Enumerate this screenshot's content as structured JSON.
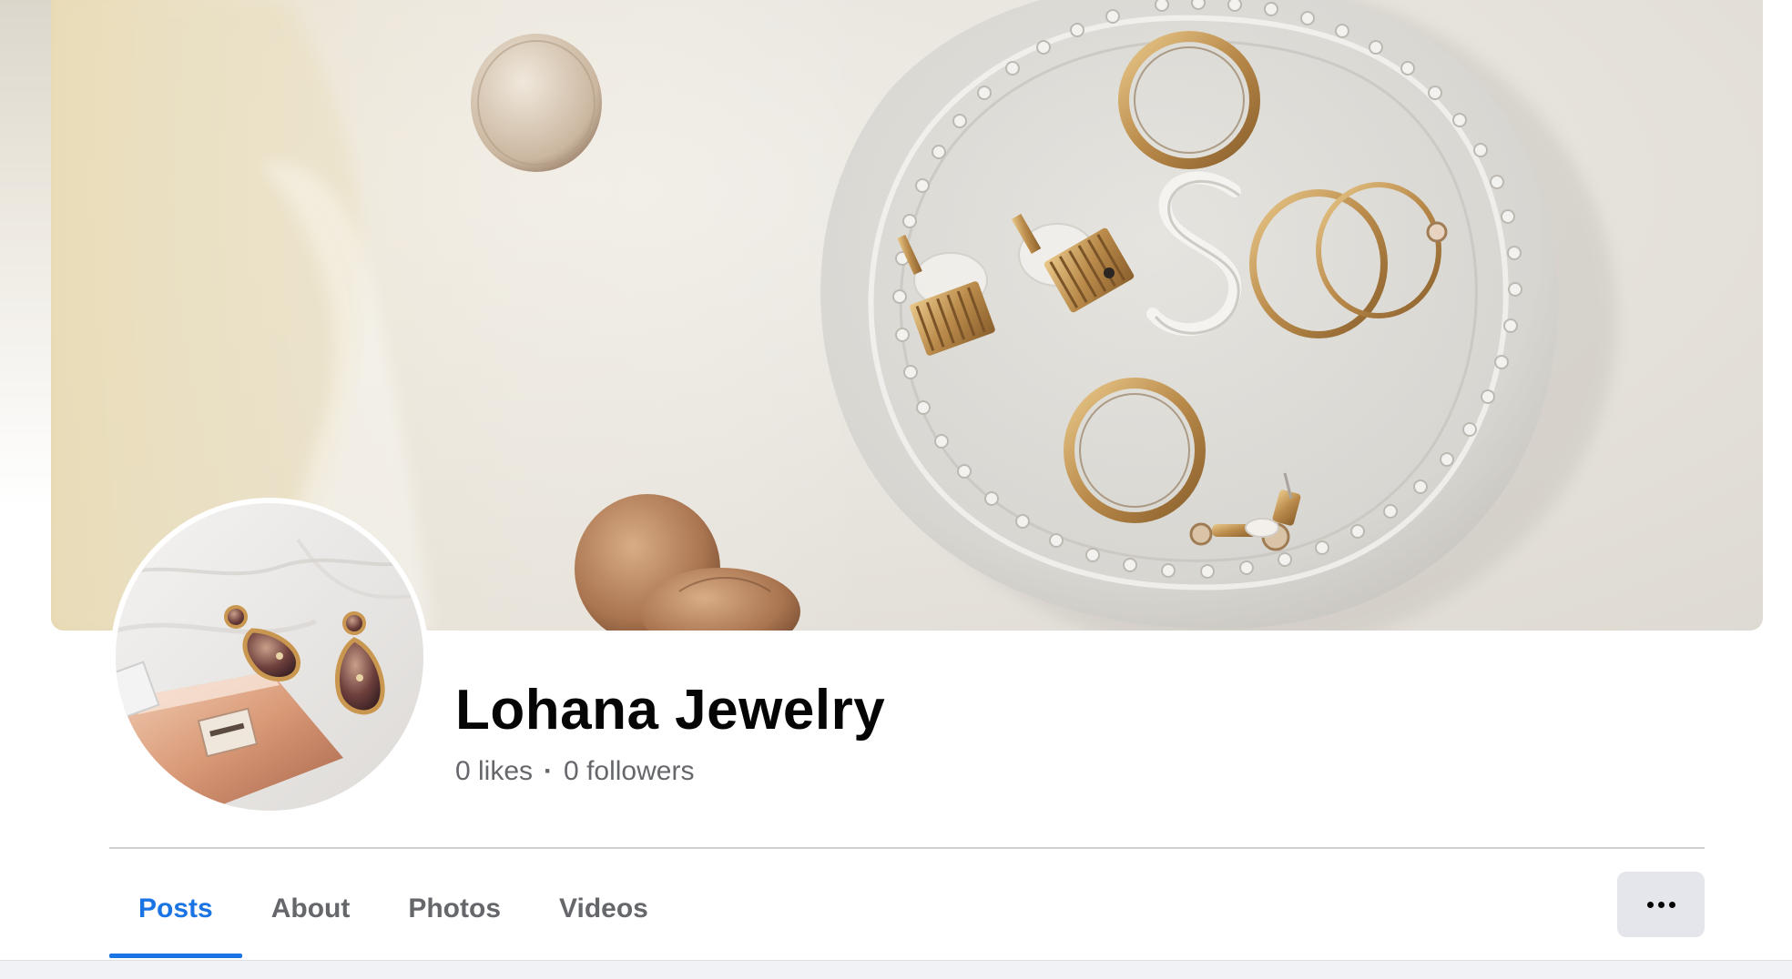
{
  "page": {
    "name": "Lohana Jewelry",
    "likes": "0 likes",
    "separator": "·",
    "followers": "0 followers"
  },
  "cover": {
    "icon": "cover-photo-jewelry-dish"
  },
  "profile_picture": {
    "icon": "profile-photo-earrings-perfume"
  },
  "tabs": [
    {
      "label": "Posts",
      "active": true
    },
    {
      "label": "About",
      "active": false
    },
    {
      "label": "Photos",
      "active": false
    },
    {
      "label": "Videos",
      "active": false
    }
  ],
  "more_button": {
    "icon": "more-horizontal-icon"
  },
  "colors": {
    "accent": "#1b74e4",
    "text_primary": "#050505",
    "text_secondary": "#65676b",
    "button_bg": "#e4e6eb"
  }
}
